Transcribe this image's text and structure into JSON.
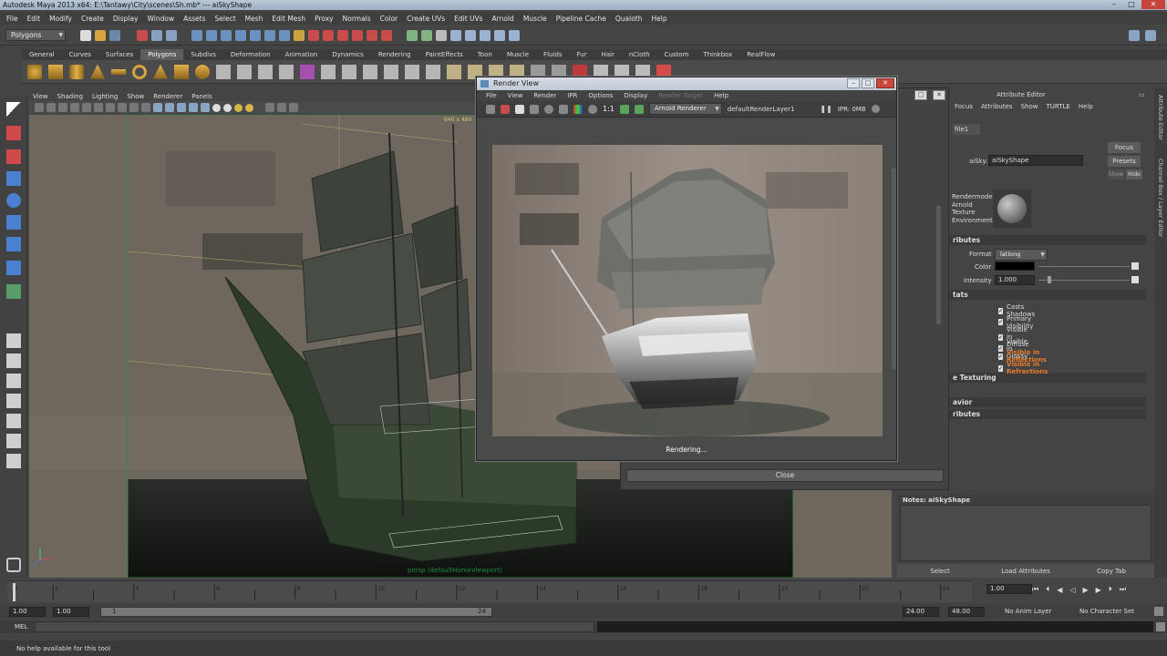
{
  "window": {
    "title": "Autodesk Maya 2013 x64: E:\\Tantawy\\City\\scenes\\Sh.mb*  ---  aiSkyShape"
  },
  "menubar": [
    "File",
    "Edit",
    "Modify",
    "Create",
    "Display",
    "Window",
    "Assets",
    "Select",
    "Mesh",
    "Edit Mesh",
    "Proxy",
    "Normals",
    "Color",
    "Create UVs",
    "Edit UVs",
    "Arnold",
    "Muscle",
    "Pipeline Cache",
    "Qualoth",
    "Help"
  ],
  "mode_selector": "Polygons",
  "shelf_tabs": [
    "General",
    "Curves",
    "Surfaces",
    "Polygons",
    "Subdivs",
    "Deformation",
    "Animation",
    "Dynamics",
    "Rendering",
    "PaintEffects",
    "Toon",
    "Muscle",
    "Fluids",
    "Fur",
    "Hair",
    "nCloth",
    "Custom",
    "Thinkbox",
    "RealFlow"
  ],
  "shelf_active": "Polygons",
  "viewport": {
    "menu": [
      "View",
      "Shading",
      "Lighting",
      "Show",
      "Renderer",
      "Panels"
    ],
    "camera_label": "persp (defaultHomeViewport)",
    "resolution_label": "640 x 480"
  },
  "render_view": {
    "title": "Render View",
    "menu": [
      "File",
      "View",
      "Render",
      "IPR",
      "Options",
      "Display",
      "Render Target",
      "Help"
    ],
    "ratio": "1:1",
    "renderer": "Arnold Renderer",
    "layer": "defaultRenderLayer1",
    "ipr": "IPR: 0MB",
    "status": "Rendering..."
  },
  "behind_dialog": {
    "close_label": "Close"
  },
  "attribute_editor": {
    "title": "Attribute Editor",
    "menu": [
      "Focus",
      "Attributes",
      "Show",
      "TURTLE",
      "Help"
    ],
    "tab": "file1",
    "node_label": "aiSky:",
    "node_value": "aiSkyShape",
    "buttons": {
      "focus": "Focus",
      "presets": "Presets",
      "show": "Show",
      "hide": "Hide"
    },
    "swatch_lines": [
      "Rendermode",
      "Arnold",
      "Texture",
      "Environment"
    ],
    "sections": {
      "attributes": "ributes",
      "stats": "tats",
      "texturing": "e Texturing",
      "behavior": "avior",
      "extra": "ributes"
    },
    "format_label": "Format",
    "format_value": "latlong",
    "color_label": "Color",
    "intensity_label": "Intensity",
    "intensity_value": "1.000",
    "checkboxes": [
      {
        "label": "Casts Shadows",
        "highlight": false
      },
      {
        "label": "Primary Visibility",
        "highlight": false
      },
      {
        "label": "Visible in Diffuse",
        "highlight": false
      },
      {
        "label": "Visible in Glossy",
        "highlight": false
      },
      {
        "label": "Visible in Reflections",
        "highlight": true
      },
      {
        "label": "Visible in Refractions",
        "highlight": true
      }
    ],
    "notes_label": "Notes: aiSkyShape",
    "bottom_buttons": [
      "Select",
      "Load Attributes",
      "Copy Tab"
    ],
    "side_tabs": [
      "Attribute Editor",
      "Channel Box / Layer Editor"
    ]
  },
  "timeline": {
    "ticks": [
      "1",
      "2",
      "4",
      "6",
      "8",
      "10",
      "12",
      "14",
      "16",
      "18",
      "20",
      "22",
      "24"
    ],
    "current_frame": "1.00",
    "range_start": "1.00",
    "range_start2": "1.00",
    "range_marker_start": "1",
    "range_marker_end": "24",
    "range_end": "24.00",
    "range_end2": "48.00",
    "anim_layer": "No Anim Layer",
    "char_set": "No Character Set"
  },
  "command_line": {
    "label": "MEL"
  },
  "help_line": "No help available for this tool",
  "colors": {
    "accent_orange": "#e87a2a",
    "viewport_green": "#1f8a3b",
    "active_tab": "#5d5d5d"
  }
}
